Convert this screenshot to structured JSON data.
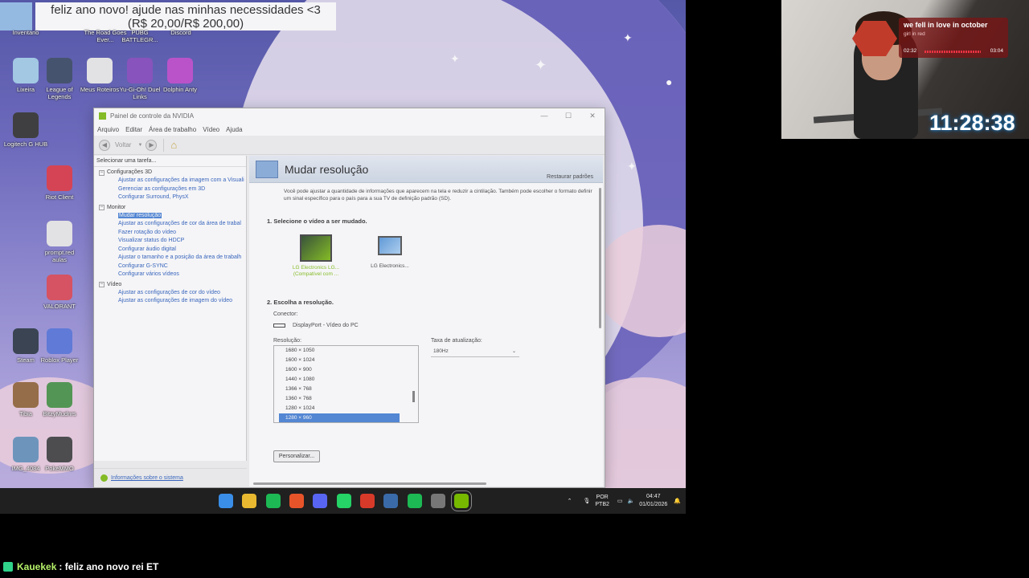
{
  "donation": {
    "line1": "feliz ano novo! ajude nas minhas necessidades <3",
    "line2": "(R$ 20,00/R$ 200,00)"
  },
  "desktop_icons": [
    {
      "label": "Inventario",
      "icon": "folder-icon",
      "color": "#3a6fd8"
    },
    {
      "label": "The Road Goes Ever...",
      "icon": "game-icon",
      "color": "#6b4a2a"
    },
    {
      "label": "PUBG BATTLEGR...",
      "icon": "pubg-icon",
      "color": "#d8a020"
    },
    {
      "label": "Discord",
      "icon": "discord-icon",
      "color": "#5865f2"
    },
    {
      "label": "Lixeira",
      "icon": "recycle-bin-icon",
      "color": "#9ac8e8"
    },
    {
      "label": "League of Legends",
      "icon": "league-icon",
      "color": "#2a3a5a"
    },
    {
      "label": "Meus Roteiros",
      "icon": "document-icon",
      "color": "#e8e8e8"
    },
    {
      "label": "Yu-Gi-Oh! Duel Links",
      "icon": "yugioh-icon",
      "color": "#7a3ab8"
    },
    {
      "label": "Dolphin Anty",
      "icon": "dolphin-icon",
      "color": "#b83ac8"
    },
    {
      "label": "Logitech G HUB",
      "icon": "logitech-icon",
      "color": "#222222"
    },
    {
      "label": "Riot Client",
      "icon": "riot-icon",
      "color": "#d8283a"
    },
    {
      "label": "prompt.red aulas",
      "icon": "document-icon",
      "color": "#e8e8e8"
    },
    {
      "label": "VALORANT",
      "icon": "valorant-icon",
      "color": "#d83a4a"
    },
    {
      "label": "Steam",
      "icon": "steam-icon",
      "color": "#1b2838"
    },
    {
      "label": "Roblox Player",
      "icon": "roblox-icon",
      "color": "#4a6ad8"
    },
    {
      "label": "Tibia",
      "icon": "tibia-icon",
      "color": "#8a5a2a"
    },
    {
      "label": "BitzyMudnrs",
      "icon": "game-icon",
      "color": "#3a8a3a"
    },
    {
      "label": "IMG_4084",
      "icon": "image-icon",
      "color": "#5a8ab8"
    },
    {
      "label": "PokeMMO",
      "icon": "pokemmo-icon",
      "color": "#333333"
    }
  ],
  "nvidia": {
    "title": "Painel de controle da NVIDIA",
    "menu": [
      "Arquivo",
      "Editar",
      "Área de trabalho",
      "Vídeo",
      "Ajuda"
    ],
    "back_label": "Voltar",
    "task_header": "Selecionar uma tarefa...",
    "tree": [
      {
        "category": "Configurações 3D",
        "items": [
          "Ajustar as configurações da imagem com a Visuali",
          "Gerenciar as configurações em 3D",
          "Configurar Surround, PhysX"
        ]
      },
      {
        "category": "Monitor",
        "items": [
          "Mudar resolução",
          "Ajustar as configurações de cor da área de trabal",
          "Fazer rotação do vídeo",
          "Visualizar status do HDCP",
          "Configurar áudio digital",
          "Ajustar o tamanho e a posição da área de trabalh",
          "Configurar G-SYNC",
          "Configurar vários vídeos"
        ]
      },
      {
        "category": "Vídeo",
        "items": [
          "Ajustar as configurações de cor do vídeo",
          "Ajustar as configurações de imagem do vídeo"
        ]
      }
    ],
    "selected_item": "Mudar resolução",
    "system_info": "Informações sobre o sistema",
    "page_title": "Mudar resolução",
    "restore": "Restaurar padrões",
    "description": "Você pode ajustar a quantidade de informações que aparecem na tela e reduzir a cintilação. Também pode escolher o formato definir um sinal específico para o país para a sua TV de definição padrão (SD).",
    "section1": "1. Selecione o vídeo a ser mudado.",
    "monitor1": "LG Electronics LG... (Compatível com ...",
    "monitor2": "LG Electronics...",
    "section2": "2. Escolha a resolução.",
    "connector_label": "Conector:",
    "connector_value": "DisplayPort - Vídeo do PC",
    "resolution_label": "Resolução:",
    "resolutions": [
      "1680 × 1050",
      "1600 × 1024",
      "1600 × 900",
      "1440 × 1080",
      "1366 × 768",
      "1360 × 768",
      "1280 × 1024",
      "1280 × 960"
    ],
    "selected_resolution": "1280 × 960",
    "refresh_label": "Taxa de atualização:",
    "refresh_value": "180Hz",
    "customize": "Personalizar..."
  },
  "taskbar": {
    "apps": [
      {
        "icon": "windows-start-icon",
        "color": "#3a8ee8"
      },
      {
        "icon": "file-explorer-icon",
        "color": "#e8b830"
      },
      {
        "icon": "spotify-icon",
        "color": "#1db954"
      },
      {
        "icon": "brave-icon",
        "color": "#e8542a"
      },
      {
        "icon": "discord-icon",
        "color": "#5865f2"
      },
      {
        "icon": "whatsapp-icon",
        "color": "#25d366"
      },
      {
        "icon": "chrome-icon",
        "color": "#d83a2a"
      },
      {
        "icon": "steam-icon",
        "color": "#3a6aa8"
      },
      {
        "icon": "spotify-icon",
        "color": "#1db954"
      },
      {
        "icon": "calculator-icon",
        "color": "#777777"
      },
      {
        "icon": "nvidia-icon",
        "color": "#76b900"
      }
    ],
    "lang": "POR",
    "layout": "PTB2",
    "time": "04:47",
    "date": "01/01/2026"
  },
  "music": {
    "song": "we fell in love in october",
    "artist": "girl in red",
    "elapsed": "02:32",
    "duration": "03:04"
  },
  "stream_clock": "11:28:38",
  "chat": {
    "user": "Kauekek",
    "message": ": feliz ano novo rei ET"
  }
}
